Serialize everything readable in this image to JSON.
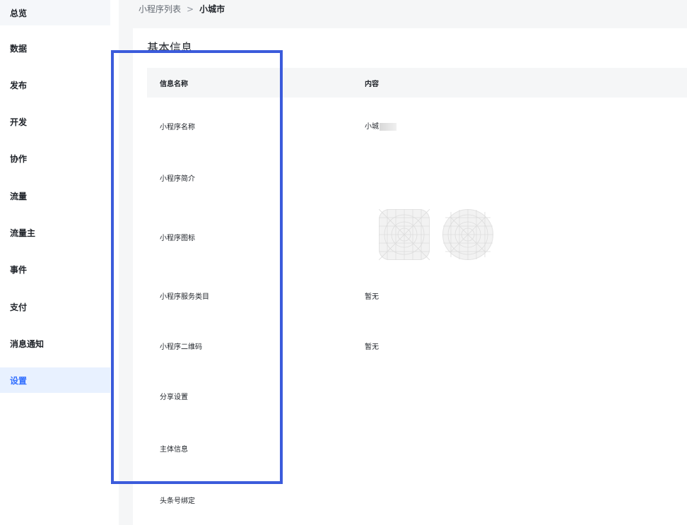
{
  "sidebar": {
    "items": [
      {
        "label": "总览",
        "state": "muted"
      },
      {
        "label": "数据",
        "state": ""
      },
      {
        "label": "发布",
        "state": ""
      },
      {
        "label": "开发",
        "state": ""
      },
      {
        "label": "协作",
        "state": ""
      },
      {
        "label": "流量",
        "state": ""
      },
      {
        "label": "流量主",
        "state": ""
      },
      {
        "label": "事件",
        "state": ""
      },
      {
        "label": "支付",
        "state": ""
      },
      {
        "label": "消息通知",
        "state": ""
      },
      {
        "label": "设置",
        "state": "active"
      }
    ]
  },
  "breadcrumb": {
    "parent": "小程序列表",
    "separator": ">",
    "current": "小城市"
  },
  "panel": {
    "title": "基本信息",
    "columns": {
      "name": "信息名称",
      "content": "内容"
    },
    "rows": [
      {
        "label": "小程序名称",
        "value": "小城"
      },
      {
        "label": "小程序简介",
        "value": ""
      },
      {
        "label": "小程序图标",
        "value": ""
      },
      {
        "label": "小程序服务类目",
        "value": "暂无"
      },
      {
        "label": "小程序二维码",
        "value": "暂无"
      },
      {
        "label": "分享设置",
        "value": ""
      },
      {
        "label": "主体信息",
        "value": ""
      },
      {
        "label": "头条号绑定",
        "value": ""
      }
    ]
  },
  "colors": {
    "accent": "#3370ff",
    "highlight_border": "#3b5bdb",
    "content_bg": "#f5f6f7",
    "active_bg": "#e8f1ff"
  },
  "icons": {
    "square_icon": "app-icon-square-placeholder",
    "round_icon": "app-icon-round-placeholder"
  }
}
